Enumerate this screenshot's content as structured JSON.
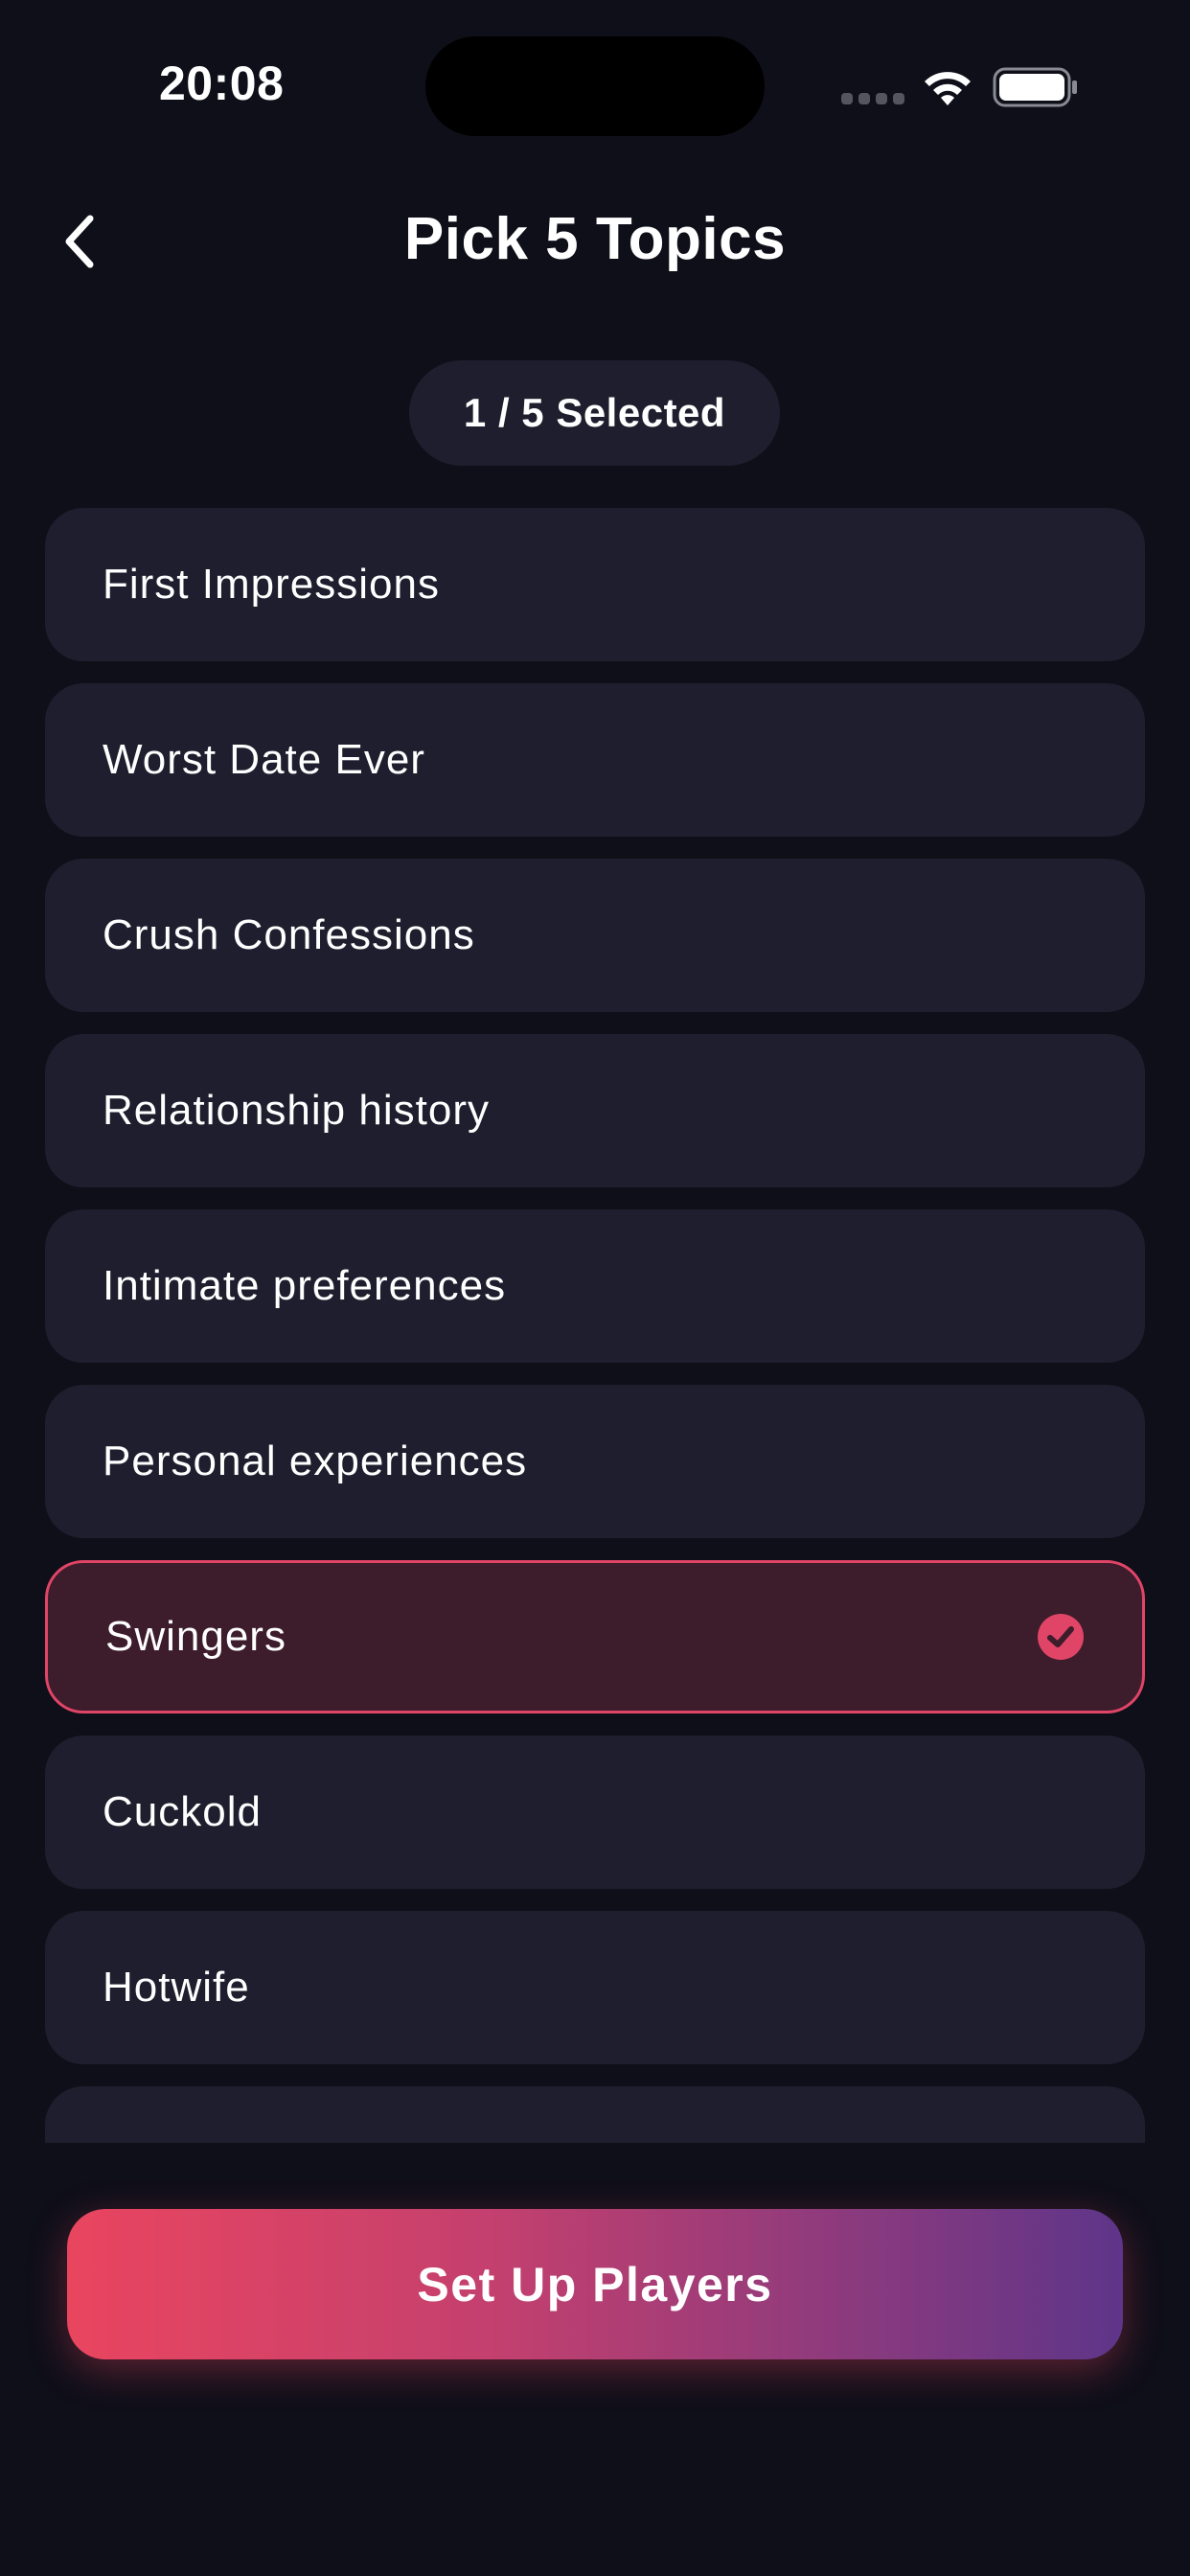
{
  "status_bar": {
    "time": "20:08"
  },
  "header": {
    "title": "Pick 5 Topics",
    "back_icon": "chevron-left-icon"
  },
  "selection": {
    "counter_text": "1 / 5 Selected",
    "selected_count": 1,
    "max_count": 5
  },
  "topics": [
    {
      "label": "First Impressions",
      "selected": false
    },
    {
      "label": "Worst Date Ever",
      "selected": false
    },
    {
      "label": "Crush Confessions",
      "selected": false
    },
    {
      "label": "Relationship history",
      "selected": false
    },
    {
      "label": "Intimate preferences",
      "selected": false
    },
    {
      "label": "Personal experiences",
      "selected": false
    },
    {
      "label": "Swingers",
      "selected": true
    },
    {
      "label": "Cuckold",
      "selected": false
    },
    {
      "label": "Hotwife",
      "selected": false
    },
    {
      "label": "",
      "selected": false
    }
  ],
  "cta": {
    "label": "Set Up Players"
  },
  "colors": {
    "background": "#0f0f19",
    "card": "#1e1e2e",
    "selected_card": "#3d1c2b",
    "accent": "#e04567",
    "gradient_start": "#e9455f",
    "gradient_end": "#5e3589"
  }
}
